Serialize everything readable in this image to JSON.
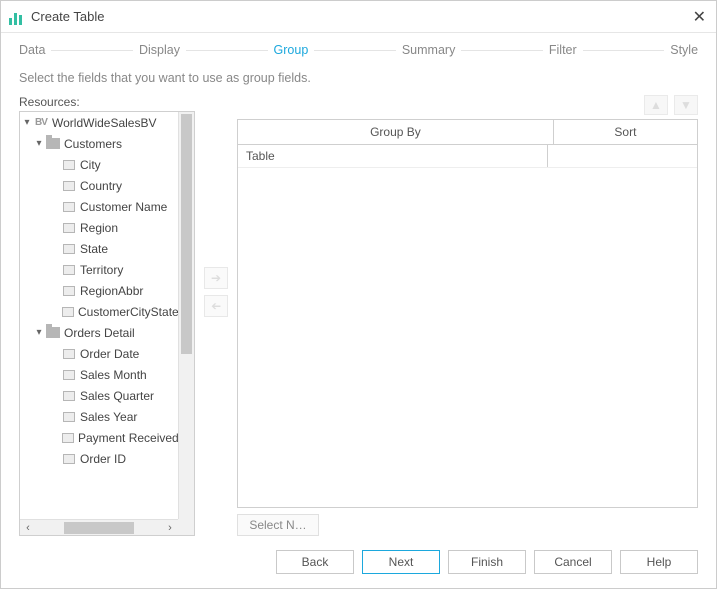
{
  "title": "Create Table",
  "steps": {
    "data": "Data",
    "display": "Display",
    "group": "Group",
    "summary": "Summary",
    "filter": "Filter",
    "style": "Style",
    "active": "group"
  },
  "instruction": "Select the fields that you want to use as group fields.",
  "resources_label": "Resources:",
  "tree": {
    "root": {
      "label": "WorldWideSalesBV"
    },
    "customers": {
      "label": "Customers",
      "fields": [
        "City",
        "Country",
        "Customer Name",
        "Region",
        "State",
        "Territory",
        "RegionAbbr",
        "CustomerCityStateZ"
      ]
    },
    "orders": {
      "label": "Orders Detail",
      "fields": [
        "Order Date",
        "Sales Month",
        "Sales Quarter",
        "Sales Year",
        "Payment Received",
        "Order ID"
      ]
    }
  },
  "grid": {
    "header_group": "Group By",
    "header_sort": "Sort",
    "row_label": "Table"
  },
  "select_button": "Select N…",
  "footer": {
    "back": "Back",
    "next": "Next",
    "finish": "Finish",
    "cancel": "Cancel",
    "help": "Help"
  }
}
